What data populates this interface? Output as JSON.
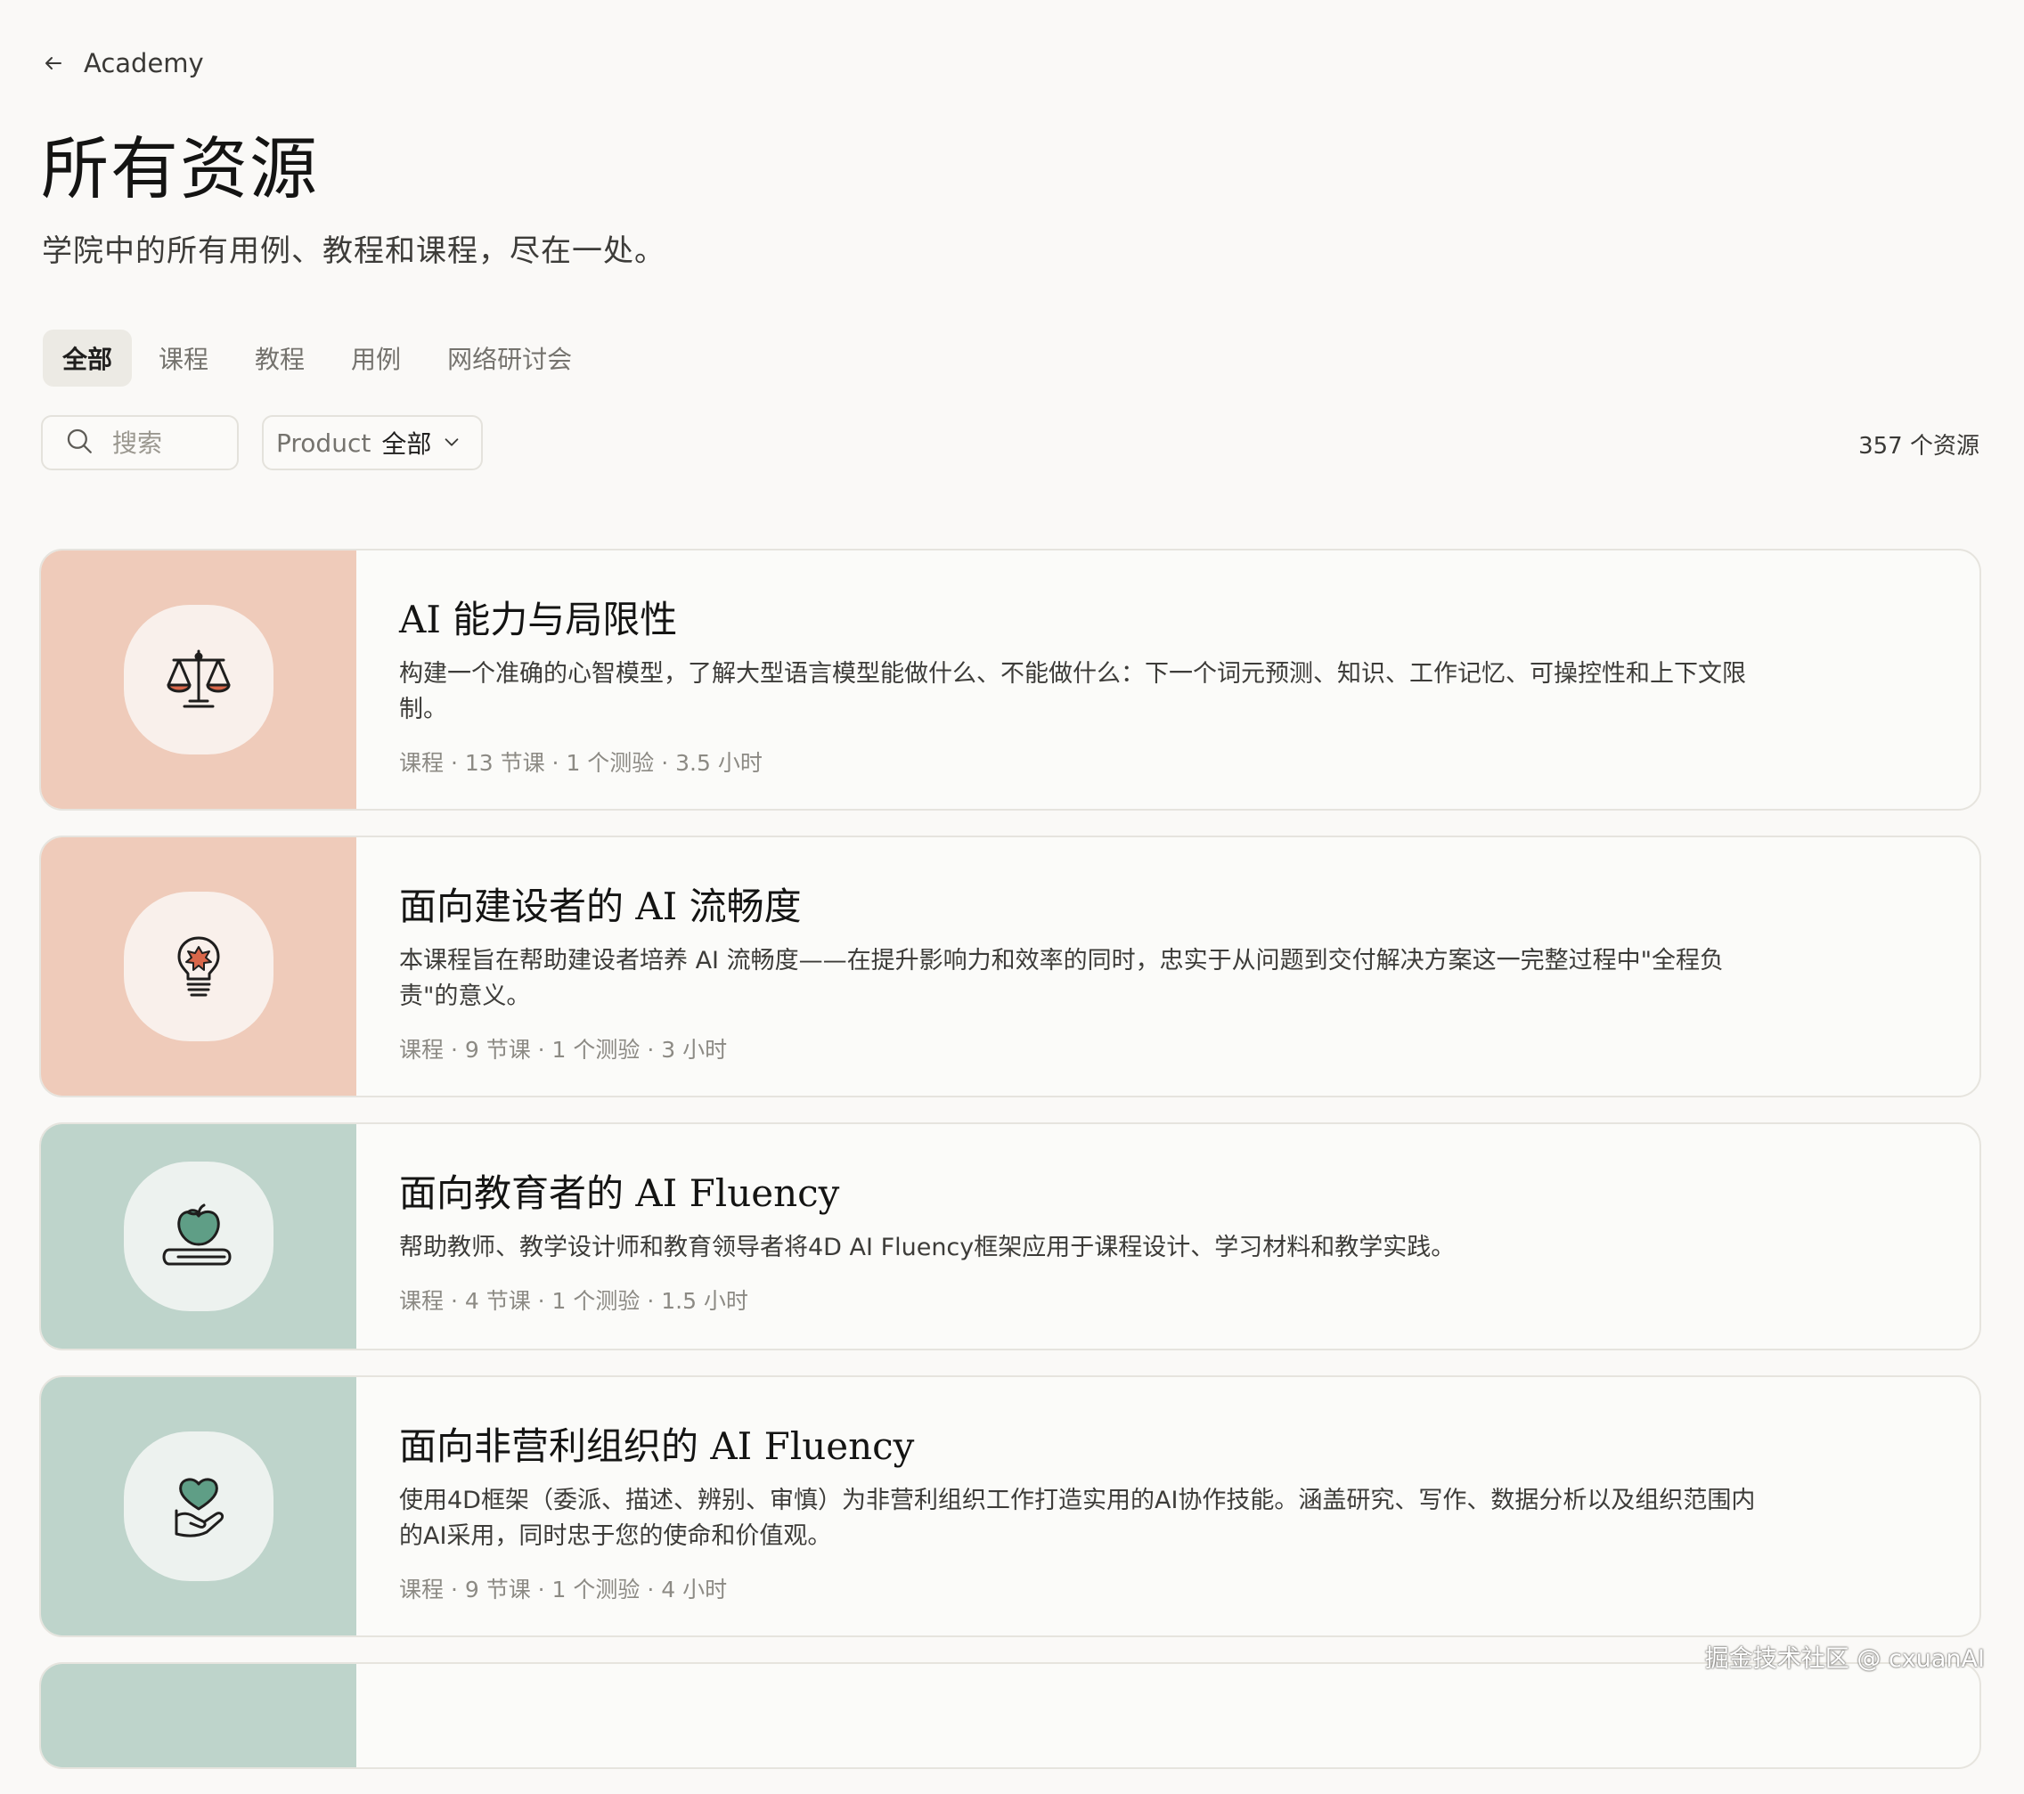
{
  "nav": {
    "back_label": "Academy"
  },
  "header": {
    "title": "所有资源",
    "subtitle": "学院中的所有用例、教程和课程，尽在一处。"
  },
  "tabs": [
    {
      "label": "全部",
      "active": true
    },
    {
      "label": "课程",
      "active": false
    },
    {
      "label": "教程",
      "active": false
    },
    {
      "label": "用例",
      "active": false
    },
    {
      "label": "网络研讨会",
      "active": false
    }
  ],
  "toolbar": {
    "search_placeholder": "搜索",
    "filter_label": "Product",
    "filter_value": "全部",
    "result_count": "357 个资源"
  },
  "cards": [
    {
      "title": "AI 能力与局限性",
      "description": "构建一个准确的心智模型，了解大型语言模型能做什么、不能做什么：下一个词元预测、知识、工作记忆、可操控性和上下文限制。",
      "meta": "课程 · 13 节课 · 1 个测验 · 3.5 小时",
      "icon": "scale-icon",
      "thumb_color": "#efcbba"
    },
    {
      "title": "面向建设者的 AI 流畅度",
      "description": "本课程旨在帮助建设者培养 AI 流畅度——在提升影响力和效率的同时，忠实于从问题到交付解决方案这一完整过程中\"全程负责\"的意义。",
      "meta": "课程 · 9 节课 · 1 个测验 · 3 小时",
      "icon": "lightbulb-icon",
      "thumb_color": "#efcbba"
    },
    {
      "title": "面向教育者的 AI Fluency",
      "description": "帮助教师、教学设计师和教育领导者将4D AI Fluency框架应用于课程设计、学习材料和教学实践。",
      "meta": "课程 · 4 节课 · 1 个测验 · 1.5 小时",
      "icon": "apple-book-icon",
      "thumb_color": "#bed4cb"
    },
    {
      "title": "面向非营利组织的 AI Fluency",
      "description": "使用4D框架（委派、描述、辨别、审慎）为非营利组织工作打造实用的AI协作技能。涵盖研究、写作、数据分析以及组织范围内的AI采用，同时忠于您的使命和价值观。",
      "meta": "课程 · 9 节课 · 1 个测验 · 4 小时",
      "icon": "heart-hand-icon",
      "thumb_color": "#bed4cb"
    },
    {
      "title": "",
      "description": "",
      "meta": "",
      "icon": "",
      "thumb_color": "#bed4cb"
    }
  ],
  "watermark": "掘金技术社区 @ cxuanAI",
  "colors": {
    "background": "#faf9f7",
    "blob": "#f9f0eb",
    "blob_green": "#edf2ef",
    "accent_red": "#d9674a",
    "accent_green": "#5f9e86"
  }
}
